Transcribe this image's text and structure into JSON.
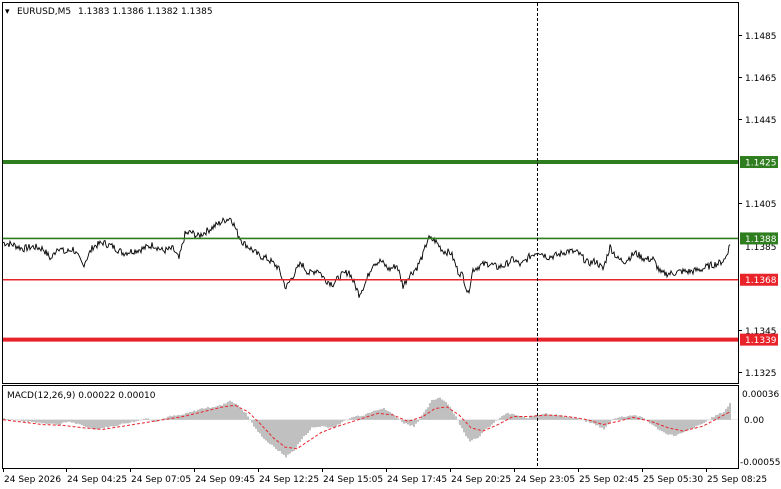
{
  "header": {
    "menu_glyph": "▾",
    "symbol": "EURUSD,M5",
    "ohlc": "1.1383 1.1386 1.1382 1.1385"
  },
  "price_axis": {
    "labels": [
      "1.1485",
      "1.1465",
      "1.1445",
      "1.1405",
      "1.1345",
      "1.1325"
    ],
    "current_price_label": "1.1385",
    "range": [
      1.1318,
      1.1502
    ]
  },
  "levels": [
    {
      "label": "1.1425",
      "price": 1.1425,
      "color": "#2e7d1e",
      "weight": "thick"
    },
    {
      "label": "1.1388",
      "price": 1.1388,
      "color": "#2e7d1e",
      "weight": "thin"
    },
    {
      "label": "1.1368",
      "price": 1.1368,
      "color": "#e8232a",
      "weight": "thin"
    },
    {
      "label": "1.1339",
      "price": 1.1339,
      "color": "#e8232a",
      "weight": "thick"
    }
  ],
  "macd": {
    "title": "MACD(12,26,9) 0.00022 0.00010",
    "axis_labels": [
      "0.00036",
      "0.00",
      "-0.00055"
    ],
    "range": [
      -0.0006,
      0.00042
    ]
  },
  "time_axis": {
    "labels": [
      "24 Sep 2026",
      "24 Sep 04:25",
      "24 Sep 07:05",
      "24 Sep 09:45",
      "24 Sep 12:25",
      "24 Sep 15:05",
      "24 Sep 17:45",
      "24 Sep 20:25",
      "24 Sep 23:05",
      "25 Sep 02:45",
      "25 Sep 05:30",
      "25 Sep 08:25"
    ]
  },
  "colors": {
    "price_line": "#000000",
    "macd_histogram": "#c0c0c0",
    "macd_signal": "#e8232a",
    "crosshair": "#000000",
    "frame": "#000000"
  },
  "chart_data": {
    "type": "line",
    "price": {
      "anchors": [
        [
          0,
          1.1386
        ],
        [
          10,
          1.1385
        ],
        [
          20,
          1.1383
        ],
        [
          30,
          1.1384
        ],
        [
          40,
          1.1383
        ],
        [
          48,
          1.1378
        ],
        [
          55,
          1.1384
        ],
        [
          62,
          1.1381
        ],
        [
          70,
          1.1383
        ],
        [
          80,
          1.1375
        ],
        [
          90,
          1.1384
        ],
        [
          100,
          1.1386
        ],
        [
          110,
          1.1384
        ],
        [
          120,
          1.1381
        ],
        [
          130,
          1.1382
        ],
        [
          140,
          1.1383
        ],
        [
          150,
          1.1385
        ],
        [
          160,
          1.1382
        ],
        [
          170,
          1.1383
        ],
        [
          176,
          1.1378
        ],
        [
          182,
          1.139
        ],
        [
          188,
          1.1391
        ],
        [
          195,
          1.1389
        ],
        [
          205,
          1.1392
        ],
        [
          215,
          1.1395
        ],
        [
          222,
          1.1397
        ],
        [
          228,
          1.1398
        ],
        [
          235,
          1.139
        ],
        [
          240,
          1.1386
        ],
        [
          248,
          1.1383
        ],
        [
          255,
          1.138
        ],
        [
          265,
          1.1378
        ],
        [
          275,
          1.1374
        ],
        [
          283,
          1.1364
        ],
        [
          290,
          1.137
        ],
        [
          298,
          1.1376
        ],
        [
          306,
          1.1371
        ],
        [
          315,
          1.1373
        ],
        [
          322,
          1.1368
        ],
        [
          330,
          1.1366
        ],
        [
          338,
          1.137
        ],
        [
          346,
          1.1372
        ],
        [
          356,
          1.1361
        ],
        [
          362,
          1.1366
        ],
        [
          370,
          1.1376
        ],
        [
          378,
          1.1377
        ],
        [
          386,
          1.1373
        ],
        [
          394,
          1.1375
        ],
        [
          400,
          1.1365
        ],
        [
          406,
          1.137
        ],
        [
          414,
          1.1374
        ],
        [
          420,
          1.138
        ],
        [
          425,
          1.1388
        ],
        [
          432,
          1.1387
        ],
        [
          440,
          1.1382
        ],
        [
          448,
          1.1381
        ],
        [
          455,
          1.1372
        ],
        [
          460,
          1.137
        ],
        [
          465,
          1.1361
        ],
        [
          470,
          1.1373
        ],
        [
          478,
          1.1375
        ],
        [
          486,
          1.1376
        ],
        [
          494,
          1.1374
        ],
        [
          502,
          1.1375
        ],
        [
          510,
          1.1378
        ],
        [
          518,
          1.1375
        ],
        [
          526,
          1.1379
        ],
        [
          535,
          1.1382
        ],
        [
          545,
          1.1379
        ],
        [
          555,
          1.138
        ],
        [
          565,
          1.1382
        ],
        [
          575,
          1.1381
        ],
        [
          585,
          1.1376
        ],
        [
          593,
          1.1377
        ],
        [
          600,
          1.1373
        ],
        [
          607,
          1.1384
        ],
        [
          615,
          1.1378
        ],
        [
          622,
          1.1377
        ],
        [
          632,
          1.1381
        ],
        [
          642,
          1.1378
        ],
        [
          650,
          1.1378
        ],
        [
          658,
          1.1371
        ],
        [
          668,
          1.1371
        ],
        [
          678,
          1.1372
        ],
        [
          688,
          1.1372
        ],
        [
          698,
          1.1373
        ],
        [
          708,
          1.1375
        ],
        [
          716,
          1.1376
        ],
        [
          722,
          1.1378
        ],
        [
          727,
          1.1385
        ]
      ]
    },
    "macd_histogram": {
      "anchors": [
        [
          0,
          2e-05
        ],
        [
          20,
          -2e-05
        ],
        [
          40,
          -4e-05
        ],
        [
          55,
          -6e-05
        ],
        [
          65,
          -2e-05
        ],
        [
          80,
          -8e-05
        ],
        [
          92,
          -0.00012
        ],
        [
          100,
          -0.0001
        ],
        [
          110,
          -8e-05
        ],
        [
          122,
          -4e-05
        ],
        [
          132,
          -2e-05
        ],
        [
          142,
          2e-05
        ],
        [
          152,
          -2e-05
        ],
        [
          165,
          4e-05
        ],
        [
          178,
          6e-05
        ],
        [
          188,
          0.0001
        ],
        [
          198,
          0.00014
        ],
        [
          208,
          0.00016
        ],
        [
          218,
          0.00018
        ],
        [
          226,
          0.00024
        ],
        [
          232,
          0.0002
        ],
        [
          242,
          8e-05
        ],
        [
          252,
          -0.00012
        ],
        [
          262,
          -0.00026
        ],
        [
          272,
          -0.00036
        ],
        [
          282,
          -0.00046
        ],
        [
          290,
          -0.00038
        ],
        [
          298,
          -0.00024
        ],
        [
          308,
          -0.0001
        ],
        [
          318,
          -8e-05
        ],
        [
          330,
          -0.0001
        ],
        [
          340,
          -2e-05
        ],
        [
          350,
          4e-05
        ],
        [
          360,
          6e-05
        ],
        [
          370,
          0.00012
        ],
        [
          380,
          0.00014
        ],
        [
          390,
          6e-05
        ],
        [
          400,
          -4e-05
        ],
        [
          410,
          -8e-05
        ],
        [
          420,
          8e-05
        ],
        [
          428,
          0.00024
        ],
        [
          436,
          0.00028
        ],
        [
          444,
          0.0002
        ],
        [
          452,
          4e-05
        ],
        [
          460,
          -0.00016
        ],
        [
          466,
          -0.00026
        ],
        [
          474,
          -0.00022
        ],
        [
          482,
          -0.00012
        ],
        [
          492,
          -2e-05
        ],
        [
          502,
          8e-05
        ],
        [
          512,
          6e-05
        ],
        [
          522,
          2e-05
        ],
        [
          532,
          6e-05
        ],
        [
          542,
          8e-05
        ],
        [
          552,
          6e-05
        ],
        [
          562,
          4e-05
        ],
        [
          572,
          2e-05
        ],
        [
          582,
          -2e-05
        ],
        [
          592,
          -6e-05
        ],
        [
          600,
          -0.00012
        ],
        [
          610,
          2e-05
        ],
        [
          620,
          4e-05
        ],
        [
          630,
          6e-05
        ],
        [
          640,
          2e-05
        ],
        [
          650,
          -8e-05
        ],
        [
          660,
          -0.00016
        ],
        [
          670,
          -0.0002
        ],
        [
          680,
          -0.00016
        ],
        [
          690,
          -0.0001
        ],
        [
          700,
          -4e-05
        ],
        [
          710,
          4e-05
        ],
        [
          720,
          0.0001
        ],
        [
          727,
          0.00022
        ]
      ]
    },
    "macd_signal": {
      "anchors": [
        [
          0,
          0.0
        ],
        [
          20,
          -3e-05
        ],
        [
          40,
          -6e-05
        ],
        [
          60,
          -7e-05
        ],
        [
          80,
          -0.0001
        ],
        [
          100,
          -0.00012
        ],
        [
          120,
          -8e-05
        ],
        [
          140,
          -4e-05
        ],
        [
          160,
          0.0
        ],
        [
          180,
          4e-05
        ],
        [
          200,
          0.0001
        ],
        [
          220,
          0.00016
        ],
        [
          232,
          0.00018
        ],
        [
          245,
          0.0001
        ],
        [
          258,
          -6e-05
        ],
        [
          270,
          -0.00022
        ],
        [
          282,
          -0.00034
        ],
        [
          294,
          -0.00036
        ],
        [
          306,
          -0.00026
        ],
        [
          318,
          -0.00016
        ],
        [
          330,
          -0.0001
        ],
        [
          345,
          -4e-05
        ],
        [
          360,
          2e-05
        ],
        [
          375,
          8e-05
        ],
        [
          390,
          6e-05
        ],
        [
          405,
          -2e-05
        ],
        [
          420,
          4e-05
        ],
        [
          432,
          0.00014
        ],
        [
          444,
          0.00016
        ],
        [
          456,
          6e-05
        ],
        [
          468,
          -0.0001
        ],
        [
          480,
          -0.00014
        ],
        [
          495,
          -6e-05
        ],
        [
          510,
          4e-05
        ],
        [
          525,
          4e-05
        ],
        [
          545,
          6e-05
        ],
        [
          565,
          4e-05
        ],
        [
          585,
          0.0
        ],
        [
          600,
          -6e-05
        ],
        [
          615,
          -2e-05
        ],
        [
          630,
          3e-05
        ],
        [
          648,
          -2e-05
        ],
        [
          665,
          -0.0001
        ],
        [
          680,
          -0.00014
        ],
        [
          700,
          -8e-05
        ],
        [
          715,
          2e-05
        ],
        [
          727,
          0.0001
        ]
      ]
    }
  }
}
